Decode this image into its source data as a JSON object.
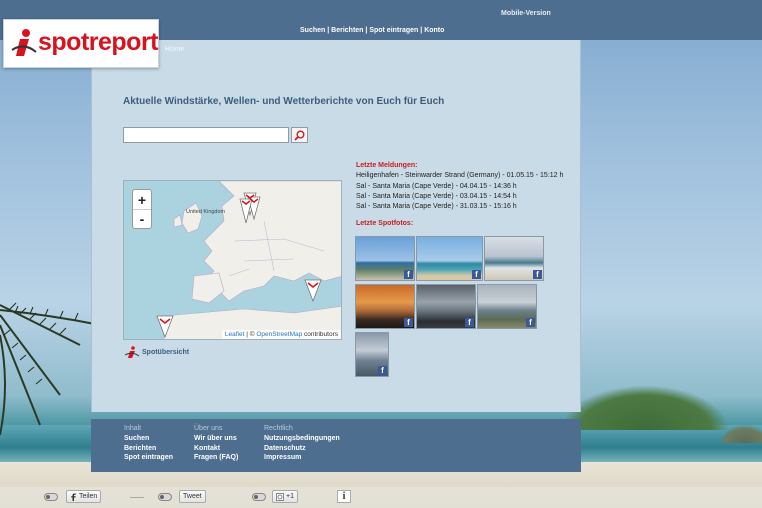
{
  "header": {
    "mobile_version": "Mobile-Version",
    "nav": [
      "Suchen",
      "Berichten",
      "Spot eintragen",
      "Konto"
    ],
    "nav_separator": " | ",
    "home_tab": "Home",
    "logo_text": "spotreport",
    "brand_color": "#d7141e"
  },
  "main": {
    "headline": "Aktuelle Windstärke, Wellen- und Wetterberichte von Euch für Euch",
    "search": {
      "value": "",
      "placeholder": ""
    },
    "map": {
      "zoom_in": "+",
      "zoom_out": "-",
      "country_label": "United Kingdom",
      "attribution_leaflet": "Leaflet",
      "attribution_sep": " | © ",
      "attribution_osm": "OpenStreetMap",
      "attribution_rest": " contributors"
    },
    "overview_link": "Spotübersicht"
  },
  "reports": {
    "title": "Letzte Meldungen:",
    "items": [
      "Heiligenhafen - Steinwarder Strand (Germany) - 01.05.15 - 15:12 h",
      "Sal - Santa Maria (Cape Verde) - 04.04.15 - 14:36 h",
      "Sal - Santa Maria (Cape Verde) - 03.04.15 - 14:54 h",
      "Sal - Santa Maria (Cape Verde) - 31.03.15 - 15:16 h"
    ]
  },
  "photos": {
    "title": "Letzte Spotfotos:",
    "fb_glyph": "f"
  },
  "footer": {
    "columns": [
      {
        "heading": "Inhalt",
        "links": [
          "Suchen",
          "Berichten",
          "Spot eintragen"
        ]
      },
      {
        "heading": "Über uns",
        "links": [
          "Wir über uns",
          "Kontakt",
          "Fragen (FAQ)"
        ]
      },
      {
        "heading": "Rechtlich",
        "links": [
          "Nutzungsbedingungen",
          "Datenschutz",
          "Impressum"
        ]
      }
    ]
  },
  "share": {
    "facebook_label": "Teilen",
    "twitter_label": "Tweet",
    "google_label": "+1",
    "info_glyph": "i"
  }
}
